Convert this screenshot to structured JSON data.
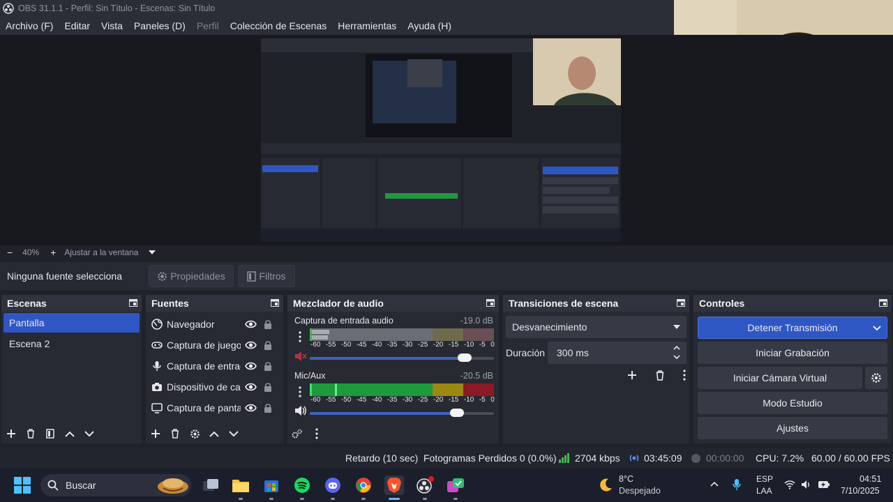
{
  "window": {
    "title": "OBS 31.1.1 - Perfil: Sin Título - Escenas: Sin Título"
  },
  "menu": [
    {
      "label": "Archivo (F)",
      "disabled": false
    },
    {
      "label": "Editar",
      "disabled": false
    },
    {
      "label": "Vista",
      "disabled": false
    },
    {
      "label": "Paneles (D)",
      "disabled": false
    },
    {
      "label": "Perfil",
      "disabled": true
    },
    {
      "label": "Colección de Escenas",
      "disabled": false
    },
    {
      "label": "Herramientas",
      "disabled": false
    },
    {
      "label": "Ayuda (H)",
      "disabled": false
    }
  ],
  "zoom": {
    "minus": "−",
    "value": "40%",
    "plus": "+",
    "fit": "Ajustar a la ventana"
  },
  "context": {
    "no_source": "Ninguna fuente selecciona",
    "properties": "Propiedades",
    "filters": "Filtros"
  },
  "scenes": {
    "title": "Escenas",
    "items": [
      {
        "label": "Pantalla",
        "selected": true
      },
      {
        "label": "Escena 2",
        "selected": false
      }
    ]
  },
  "sources": {
    "title": "Fuentes",
    "items": [
      {
        "label": "Navegador",
        "icon": "globe-icon"
      },
      {
        "label": "Captura de juego",
        "icon": "gamepad-icon"
      },
      {
        "label": "Captura de entrada de audio",
        "icon": "microphone-icon"
      },
      {
        "label": "Dispositivo de captura de vídeo",
        "icon": "camera-icon"
      },
      {
        "label": "Captura de pantalla",
        "icon": "monitor-icon"
      }
    ]
  },
  "mixer": {
    "title": "Mezclador de audio",
    "channels": [
      {
        "name": "Captura de entrada audio",
        "db": "-19.0 dB",
        "muted": true,
        "volume": 0.84
      },
      {
        "name": "Mic/Aux",
        "db": "-20.5 dB",
        "muted": false,
        "volume": 0.8
      }
    ],
    "scale": [
      "-60",
      "-55",
      "-50",
      "-45",
      "-40",
      "-35",
      "-30",
      "-25",
      "-20",
      "-15",
      "-10",
      "-5",
      "0"
    ]
  },
  "transitions": {
    "title": "Transiciones de escena",
    "selected": "Desvanecimiento",
    "duration_label": "Duración",
    "duration_value": "300 ms"
  },
  "controls": {
    "title": "Controles",
    "stop_stream": "Detener Transmisión",
    "start_record": "Iniciar Grabación",
    "start_vcam": "Iniciar Cámara Virtual",
    "studio_mode": "Modo Estudio",
    "settings": "Ajustes"
  },
  "status": {
    "delay": "Retardo (10 sec)",
    "dropped": "Fotogramas Perdidos 0 (0.0%)",
    "bitrate": "2704 kbps",
    "stream_time": "03:45:09",
    "record_time": "00:00:00",
    "cpu": "CPU: 7.2%",
    "fps": "60.00 / 60.00 FPS"
  },
  "taskbar": {
    "search": "Buscar",
    "weather_temp": "8°C",
    "weather_desc": "Despejado",
    "lang_top": "ESP",
    "lang_bottom": "LAA",
    "time": "04:51",
    "date": "7/10/2025"
  },
  "colors": {
    "accent": "#2f57c4",
    "meter_green": "#1e9a3c",
    "meter_yellow": "#9a8a14",
    "meter_red": "#8a1a26",
    "bitrate_green": "#3fb950"
  }
}
